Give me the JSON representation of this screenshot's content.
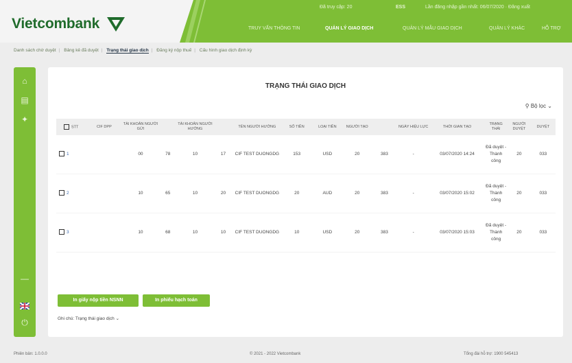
{
  "header": {
    "logo": "Vietcombank",
    "topbar": [
      "Đã truy cập: 20",
      "ESS",
      "Lần đăng nhập gần nhất: 06/07/2020 · Đăng xuất"
    ],
    "nav": [
      "TRUY VẤN THÔNG TIN",
      "QUẢN LÝ GIAO DỊCH",
      "QUẢN LÝ MẪU GIAO DỊCH",
      "QUẢN LÝ KHÁC",
      "HỖ TRỢ"
    ],
    "active_nav": 1
  },
  "subnav": {
    "items": [
      "Danh sách chờ duyệt",
      "Bảng kê đã duyệt",
      "Trạng thái giao dịch",
      "Đăng ký nộp thuế",
      "Cấu hình giao dịch định kỳ"
    ],
    "active": 2
  },
  "sidebar": {
    "icons": [
      "home-icon",
      "card-icon",
      "satellite-icon",
      "minus-icon",
      "flag-uk-icon",
      "power-icon"
    ]
  },
  "page": {
    "title": "TRẠNG THÁI GIAO DỊCH",
    "filter_label": "Bộ lọc",
    "table": {
      "headers": [
        "STT",
        "CIF DPP",
        "TÀI KHOẢN NGƯỜI GỬI",
        "",
        "TÀI KHOẢN NGƯỜI HƯỞNG",
        "",
        "TÊN NGƯỜI HƯỞNG",
        "SỐ TIỀN",
        "LOẠI TIỀN",
        "NGƯỜI TẠO",
        "",
        "NGÀY HIỆU LỰC",
        "THỜI GIAN TẠO",
        "TRẠNG THÁI",
        "NGƯỜI DUYỆT",
        "DUYỆT"
      ],
      "rows": [
        [
          "1",
          "",
          "00",
          "78",
          "10",
          "17",
          "CIF TEST DUONGDG",
          "153",
          "USD",
          "20",
          "383",
          "-",
          "03/07/2020 14:24",
          "Đã duyệt - Thành công",
          "20",
          "033"
        ],
        [
          "2",
          "",
          "10",
          "65",
          "10",
          "20",
          "CIF TEST DUONGDG",
          "20",
          "AUD",
          "20",
          "383",
          "-",
          "03/07/2020 15:02",
          "Đã duyệt - Thành công",
          "20",
          "033"
        ],
        [
          "3",
          "",
          "10",
          "68",
          "10",
          "10",
          "CIF TEST DUONGDG",
          "10",
          "USD",
          "20",
          "383",
          "-",
          "03/07/2020 15:03",
          "Đã duyệt - Thành công",
          "20",
          "033"
        ]
      ]
    },
    "buttons": [
      "In giấy nộp tiền NSNN",
      "In phiếu hạch toán"
    ],
    "note": "Ghi chú: Trạng thái giao dịch"
  },
  "footer": {
    "left": "Phiên bản: 1.0.0.0",
    "center": "© 2021 - 2022 Vietcombank",
    "right": "Tổng đài hỗ trợ: 1900 545413"
  }
}
